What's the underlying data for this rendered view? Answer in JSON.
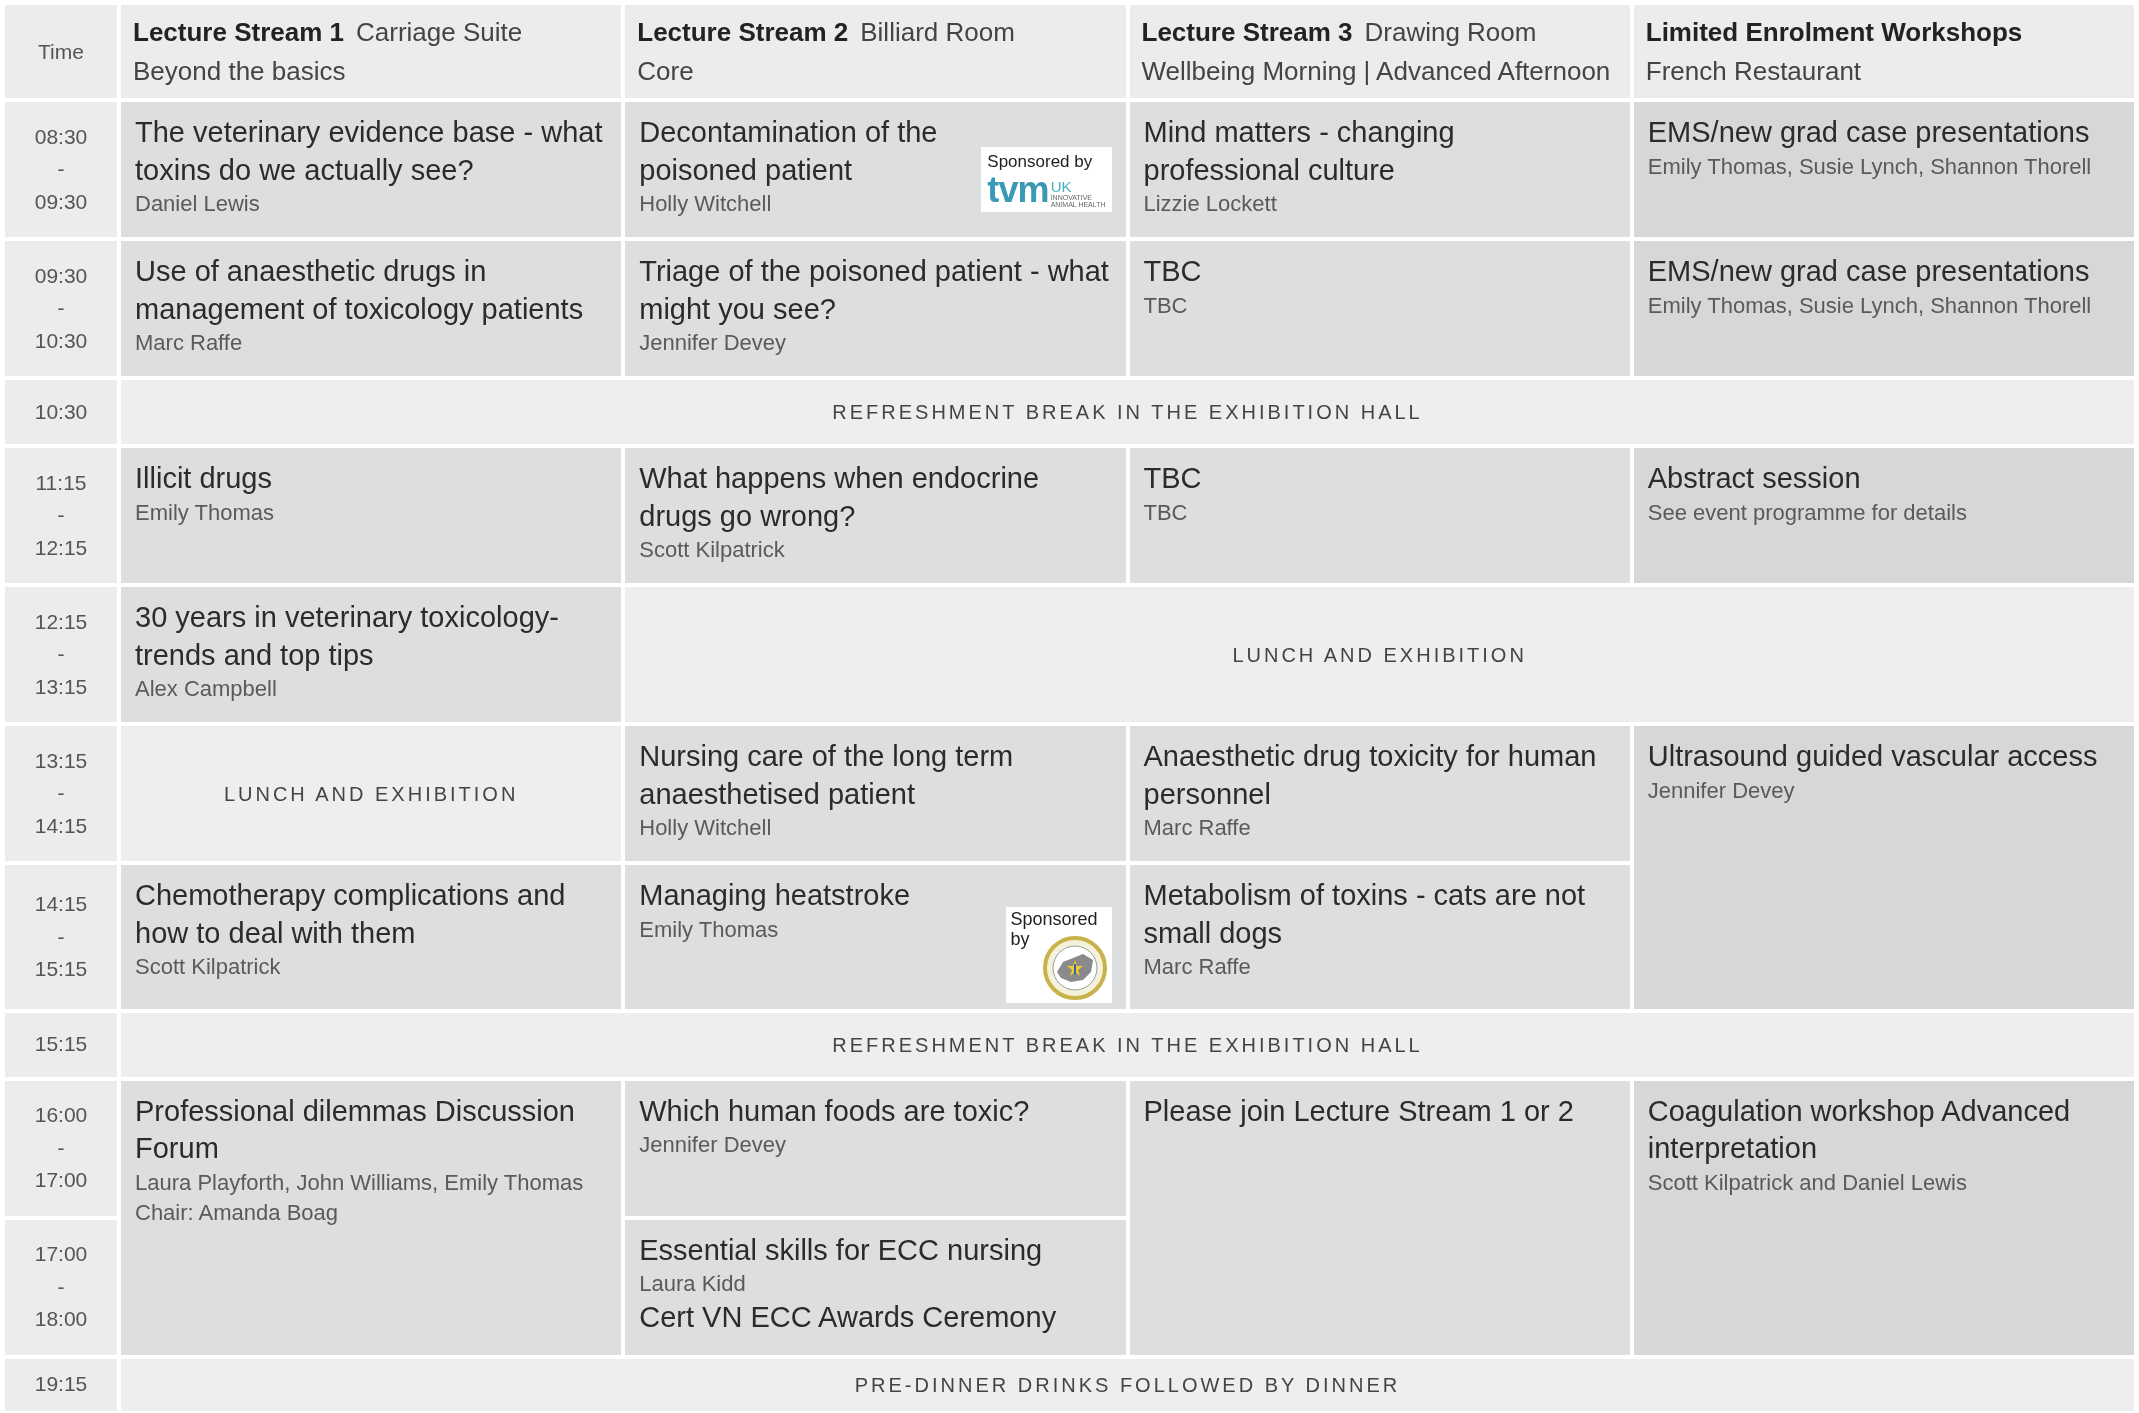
{
  "header": {
    "time_label": "Time",
    "columns": [
      {
        "title": "Lecture Stream 1",
        "room": "Carriage Suite",
        "subtitle": "Beyond the basics"
      },
      {
        "title": "Lecture Stream 2",
        "room": "Billiard Room",
        "subtitle": "Core"
      },
      {
        "title": "Lecture Stream 3",
        "room": "Drawing Room",
        "subtitle": "Wellbeing Morning | Advanced Afternoon"
      },
      {
        "title": "Limited Enrolment Workshops",
        "subtitle": "French Restaurant"
      }
    ]
  },
  "rows": [
    {
      "kind": "slot",
      "times": [
        "08:30",
        "-",
        "09:30"
      ],
      "cells": [
        {
          "kind": "session",
          "lines": [
            {
              "kind": "title",
              "text": "The veterinary evidence base - what toxins do we actually see?"
            },
            {
              "kind": "speaker",
              "text": "Daniel Lewis"
            }
          ]
        },
        {
          "kind": "session",
          "lines": [
            {
              "kind": "title",
              "text": "Decontamination of the poisoned patient"
            },
            {
              "kind": "speaker",
              "text": "Holly Witchell"
            }
          ],
          "sponsor": {
            "label": "Sponsored by",
            "logo": {
              "kind": "wordmark",
              "mark": "tvm",
              "country": "UK",
              "tagline": [
                "INNOVATIVE",
                "ANIMAL HEALTH"
              ]
            }
          }
        },
        {
          "kind": "session",
          "lines": [
            {
              "kind": "title",
              "text": "Mind matters - changing professional culture"
            },
            {
              "kind": "speaker",
              "text": "Lizzie Lockett"
            }
          ]
        },
        {
          "kind": "workshop",
          "lines": [
            {
              "kind": "title",
              "text": "EMS/new grad case  presentations"
            },
            {
              "kind": "speaker",
              "text": "Emily Thomas, Susie Lynch, Shannon Thorell"
            }
          ]
        }
      ]
    },
    {
      "kind": "slot",
      "times": [
        "09:30",
        "-",
        "10:30"
      ],
      "cells": [
        {
          "kind": "session",
          "lines": [
            {
              "kind": "title",
              "text": "Use of anaesthetic drugs in management of toxicology patients"
            },
            {
              "kind": "speaker",
              "text": "Marc Raffe"
            }
          ]
        },
        {
          "kind": "session",
          "lines": [
            {
              "kind": "title",
              "text": "Triage of the poisoned patient  - what might you see?"
            },
            {
              "kind": "speaker",
              "text": "Jennifer Devey"
            }
          ]
        },
        {
          "kind": "session",
          "lines": [
            {
              "kind": "title",
              "text": "TBC"
            },
            {
              "kind": "speaker",
              "text": "TBC"
            }
          ]
        },
        {
          "kind": "workshop",
          "lines": [
            {
              "kind": "title",
              "text": "EMS/new grad case  presentations"
            },
            {
              "kind": "speaker",
              "text": "Emily Thomas, Susie Lynch, Shannon Thorell"
            }
          ]
        }
      ]
    },
    {
      "kind": "break",
      "times": [
        "10:30"
      ],
      "text": "REFRESHMENT BREAK IN THE EXHIBITION HALL"
    },
    {
      "kind": "slot",
      "times": [
        "11:15",
        "-",
        "12:15"
      ],
      "cells": [
        {
          "kind": "session",
          "lines": [
            {
              "kind": "title",
              "text": "Illicit drugs"
            },
            {
              "kind": "speaker",
              "text": "Emily Thomas"
            }
          ]
        },
        {
          "kind": "session",
          "lines": [
            {
              "kind": "title",
              "text": "What happens when endocrine drugs go wrong?"
            },
            {
              "kind": "speaker",
              "text": "Scott Kilpatrick"
            }
          ]
        },
        {
          "kind": "session",
          "lines": [
            {
              "kind": "title",
              "text": "TBC"
            },
            {
              "kind": "speaker",
              "text": "TBC"
            }
          ]
        },
        {
          "kind": "workshop",
          "lines": [
            {
              "kind": "title",
              "text": "Abstract session"
            },
            {
              "kind": "speaker",
              "text": "See event programme for details"
            }
          ]
        }
      ]
    },
    {
      "kind": "slot",
      "times": [
        "12:15",
        "-",
        "13:15"
      ],
      "cells": [
        {
          "kind": "session",
          "lines": [
            {
              "kind": "title",
              "text": "30 years in veterinary toxicology- trends and top tips"
            },
            {
              "kind": "speaker",
              "text": "Alex Campbell"
            }
          ]
        },
        {
          "kind": "break",
          "wide": true,
          "text": "LUNCH AND EXHIBITION"
        }
      ]
    },
    {
      "kind": "slot",
      "times": [
        "13:15",
        "-",
        "14:15"
      ],
      "cells": [
        {
          "kind": "break",
          "wide": false,
          "text": "LUNCH AND EXHIBITION"
        },
        {
          "kind": "session",
          "lines": [
            {
              "kind": "title",
              "text": "Nursing care of the long term anaesthetised patient"
            },
            {
              "kind": "speaker",
              "text": "Holly Witchell"
            }
          ]
        },
        {
          "kind": "session",
          "lines": [
            {
              "kind": "title",
              "text": "Anaesthetic drug toxicity for human personnel"
            },
            {
              "kind": "speaker",
              "text": "Marc Raffe"
            }
          ]
        },
        {
          "kind": "workshop",
          "tall": true,
          "lines": [
            {
              "kind": "title",
              "text": "Ultrasound guided vascular access"
            },
            {
              "kind": "speaker",
              "text": "Jennifer Devey"
            }
          ]
        }
      ]
    },
    {
      "kind": "slot",
      "times": [
        "14:15",
        "-",
        "15:15"
      ],
      "cells": [
        {
          "kind": "session",
          "lines": [
            {
              "kind": "title",
              "text": "Chemotherapy complications and how to deal with them"
            },
            {
              "kind": "speaker",
              "text": "Scott Kilpatrick"
            }
          ]
        },
        {
          "kind": "session",
          "lines": [
            {
              "kind": "title",
              "text": "Managing heatstroke"
            },
            {
              "kind": "speaker",
              "text": "Emily Thomas"
            }
          ],
          "sponsor": {
            "label": "Sponsored by",
            "logo": {
              "kind": "emblem"
            }
          }
        },
        {
          "kind": "session",
          "lines": [
            {
              "kind": "title",
              "text": "Metabolism of toxins - cats are not small dogs"
            },
            {
              "kind": "speaker",
              "text": "Marc Raffe"
            }
          ]
        }
      ]
    },
    {
      "kind": "break",
      "times": [
        "15:15"
      ],
      "text": "REFRESHMENT BREAK IN THE EXHIBITION HALL"
    },
    {
      "kind": "slot",
      "times": [
        "16:00",
        "-",
        "17:00"
      ],
      "cells": [
        {
          "kind": "session",
          "tall": true,
          "lines": [
            {
              "kind": "title",
              "text": "Professional dilemmas Discussion Forum"
            },
            {
              "kind": "speaker",
              "text": "Laura Playforth, John Williams, Emily Thomas"
            },
            {
              "kind": "speaker",
              "text": "Chair: Amanda Boag"
            }
          ]
        },
        {
          "kind": "session",
          "lines": [
            {
              "kind": "title",
              "text": "Which human foods are toxic?"
            },
            {
              "kind": "speaker",
              "text": "Jennifer Devey"
            }
          ]
        },
        {
          "kind": "session",
          "tall": true,
          "lines": [
            {
              "kind": "title",
              "text": "Please join Lecture Stream 1 or 2"
            }
          ]
        },
        {
          "kind": "workshop",
          "tall": true,
          "lines": [
            {
              "kind": "title",
              "text": "Coagulation workshop Advanced interpretation"
            },
            {
              "kind": "speaker",
              "text": "Scott Kilpatrick and Daniel Lewis"
            }
          ]
        }
      ]
    },
    {
      "kind": "slot",
      "times": [
        "17:00",
        "-",
        "18:00"
      ],
      "cells": [
        {
          "kind": "session",
          "lines": [
            {
              "kind": "title",
              "text": "Essential skills for ECC nursing"
            },
            {
              "kind": "speaker",
              "text": "Laura Kidd"
            },
            {
              "kind": "title",
              "text": "Cert VN ECC Awards Ceremony"
            }
          ]
        }
      ]
    },
    {
      "kind": "break",
      "times": [
        "19:15"
      ],
      "text": "PRE-DINNER DRINKS FOLLOWED BY DINNER"
    }
  ]
}
